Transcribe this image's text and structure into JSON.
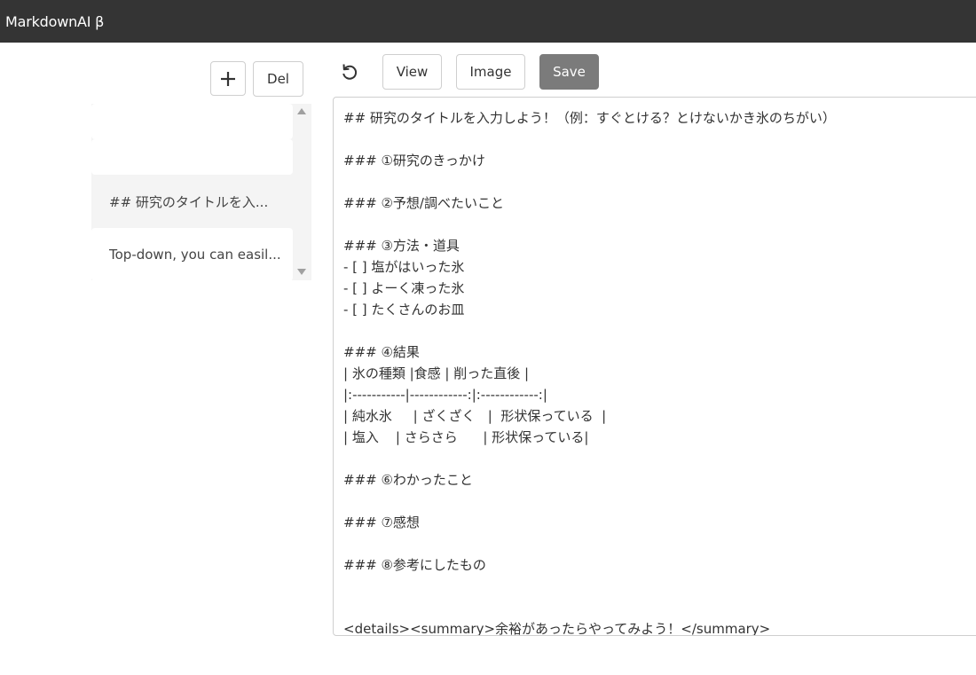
{
  "app": {
    "title": "MarkdownAI β"
  },
  "sidebar": {
    "add_label": "+",
    "delete_label": "Del",
    "notes": [
      {
        "title": ""
      },
      {
        "title": ""
      },
      {
        "title": "## 研究のタイトルを入..."
      },
      {
        "title": "Top-down, you can easil..."
      }
    ]
  },
  "toolbar": {
    "undo_icon": "undo-icon",
    "view_label": "View",
    "image_label": "Image",
    "save_label": "Save"
  },
  "editor": {
    "lines": [
      "## 研究のタイトルを入力しよう！（例：すぐとける？とけないかき氷のちがい）",
      "",
      "### ①研究のきっかけ",
      "",
      "### ②予想/調べたいこと",
      "",
      "### ③方法・道具",
      "- [ ] 塩がはいった氷",
      "- [ ] よーく凍った氷",
      "- [ ] たくさんのお皿",
      "",
      "### ④結果",
      "| 氷の種類 |食感 | 削った直後 |",
      "|:-----------|------------:|:------------:|",
      "| 純水氷     | ざくざく   |  形状保っている  |",
      "| 塩入    | さらさら      | 形状保っている|",
      "",
      "### ⑥わかったこと",
      "",
      "### ⑦感想",
      "",
      "### ⑧参考にしたもの",
      "",
      "",
      "<details><summary>余裕があったらやってみよう！</summary>"
    ]
  },
  "colors": {
    "topbar": "#343434",
    "save_button": "#7b7b7b",
    "list_background": "#f4f4f4"
  }
}
